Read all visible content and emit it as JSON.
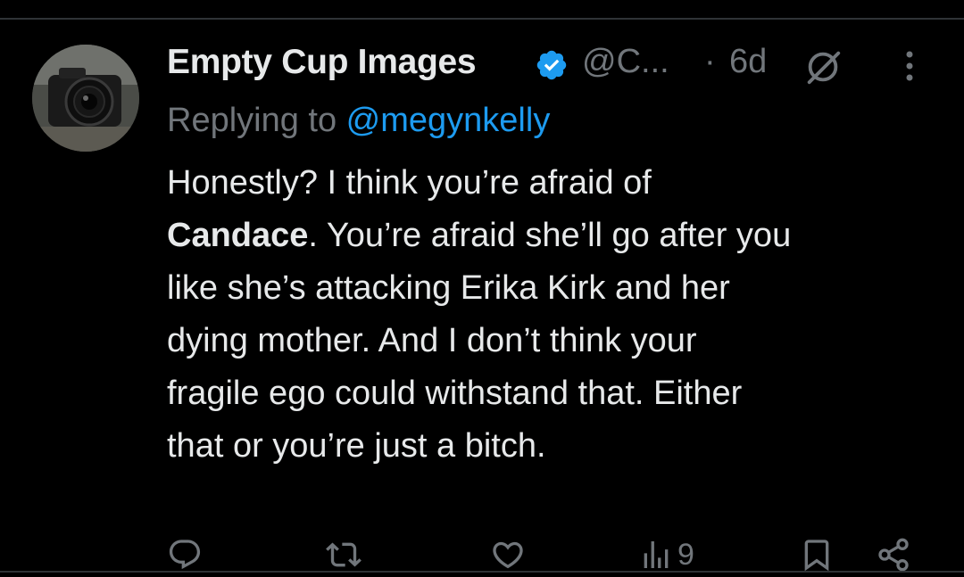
{
  "tweet": {
    "author": {
      "display_name": "Empty Cup Images",
      "handle": "@C...",
      "verified": true,
      "avatar_icon": "camera-avatar"
    },
    "separator": "·",
    "timestamp": "6d",
    "replying_prefix": "Replying to ",
    "replying_handle": "@megynkelly",
    "body": {
      "line1": "Honestly? I think you’re afraid of",
      "line2_bold": "Candace",
      "line2_rest": ". You’re afraid she’ll go after you",
      "line3": "like she’s attacking Erika Kirk and her",
      "line4": "dying mother. And I don’t think your",
      "line5": "fragile ego could withstand that. Either",
      "line6": "that or you’re just a bitch."
    },
    "actions": {
      "reply_icon": "reply-icon",
      "retweet_icon": "retweet-icon",
      "like_icon": "like-icon",
      "views_icon": "views-icon",
      "views_count": "9",
      "bookmark_icon": "bookmark-icon",
      "share_icon": "share-icon"
    }
  },
  "colors": {
    "background": "#000000",
    "text": "#e7e9ea",
    "muted": "#71767b",
    "accent": "#1d9bf0",
    "divider": "#2f3336"
  }
}
